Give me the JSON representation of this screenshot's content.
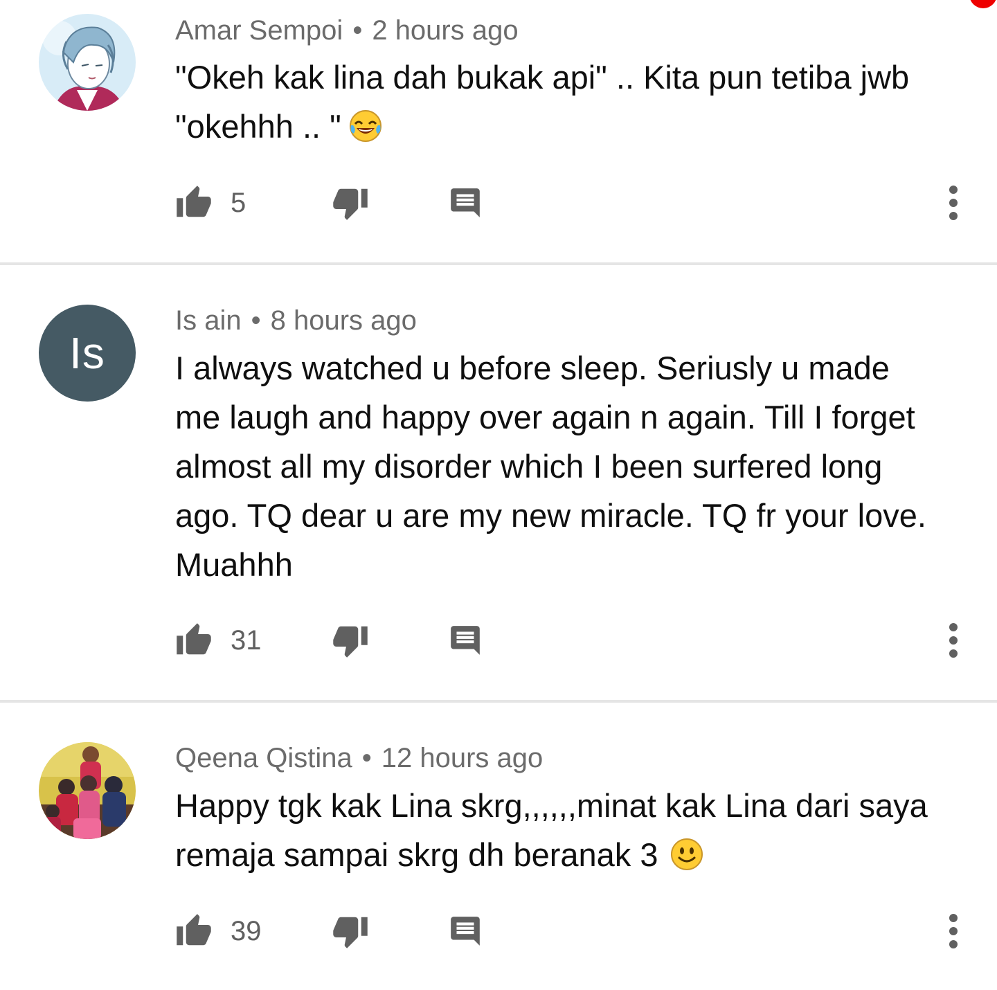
{
  "comments": [
    {
      "author": "Amar Sempoi",
      "separator": "•",
      "time": "2 hours ago",
      "lines": [
        "\"Okeh kak lina dah bukak api\" .. Kita pun tetiba jwb",
        "\"okehhh .. \""
      ],
      "emoji": "tears-of-joy-emoji",
      "likes": "5",
      "avatar": "anime-character-avatar"
    },
    {
      "author": "Is ain",
      "separator": "•",
      "time": "8 hours ago",
      "lines": [
        "I always watched u before sleep. Seriusly u made",
        "me laugh and happy over again n again. Till I forget",
        "almost all my disorder which I been surfered long",
        "ago. TQ dear u are my new miracle. TQ fr your love.",
        "Muahhh"
      ],
      "likes": "31",
      "avatar_initials": "Is",
      "avatar_color": "#455a64"
    },
    {
      "author": "Qeena Qistina",
      "separator": "•",
      "time": "12 hours ago",
      "lines": [
        "Happy tgk kak Lina skrg,,,,,,minat kak Lina dari saya",
        "remaja sampai skrg dh beranak 3"
      ],
      "emoji": "smile-emoji",
      "likes": "39",
      "avatar": "family-photo-avatar"
    }
  ],
  "icons": {
    "like": "thumbs-up-icon",
    "dislike": "thumbs-down-icon",
    "reply": "reply-icon",
    "more": "more-vertical-icon"
  },
  "colors": {
    "icon": "#606060",
    "meta_text": "#6b6b6b",
    "body_text": "#0f0f0f",
    "divider": "#e5e5e5",
    "notification": "#ee0000"
  }
}
